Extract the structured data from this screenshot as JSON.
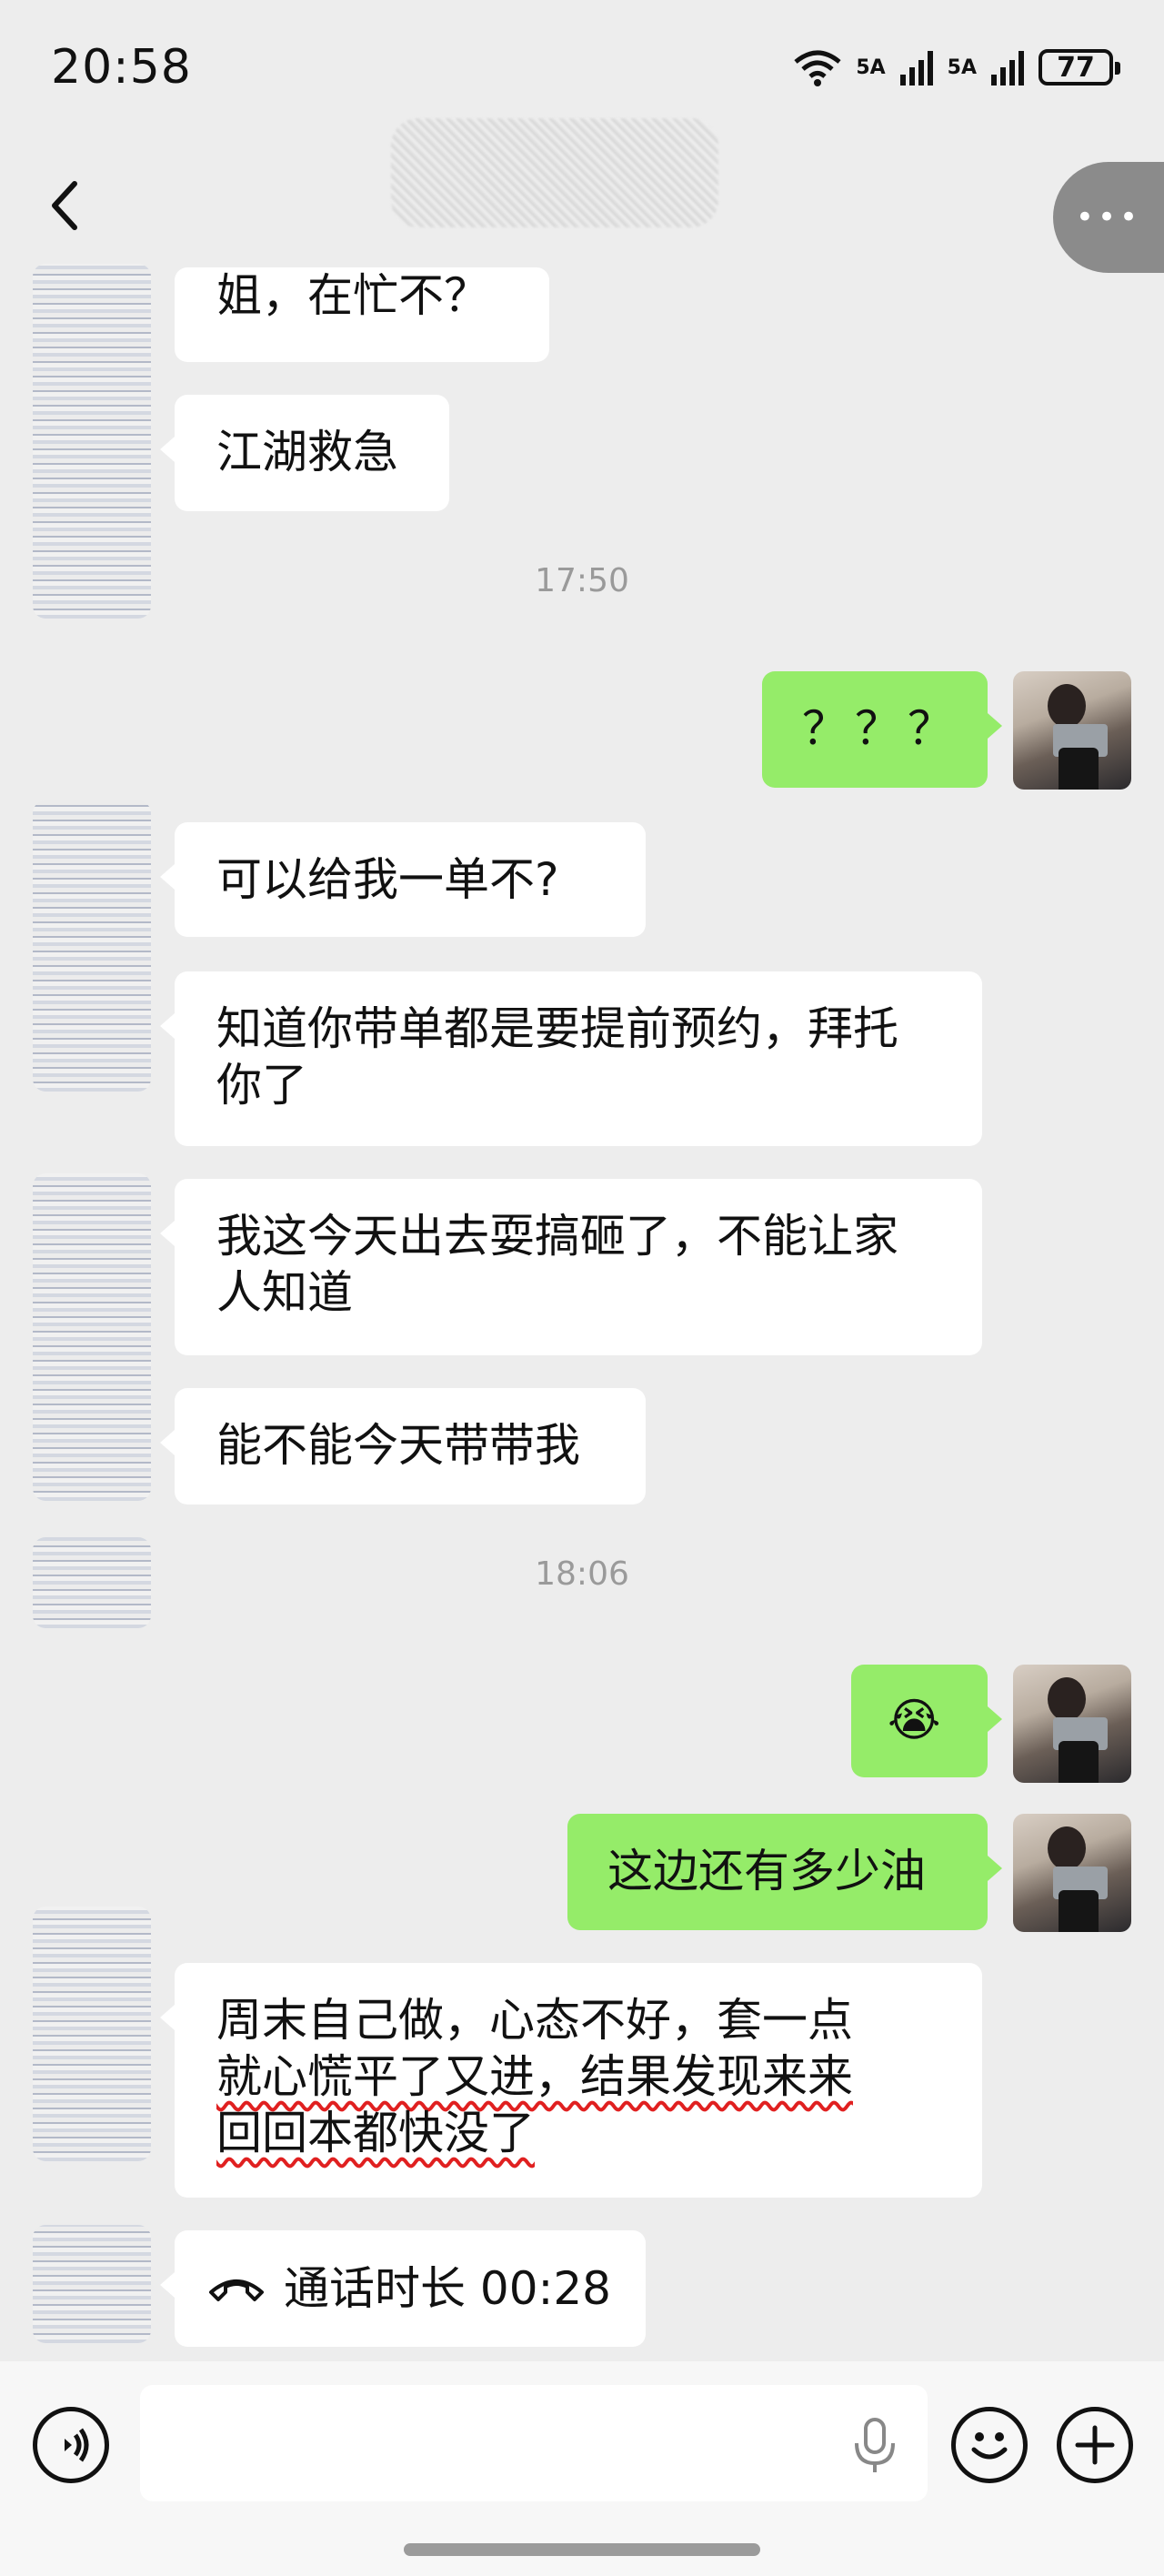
{
  "status_bar": {
    "time": "20:58",
    "battery": "77",
    "signal1": "5A",
    "signal2": "5A"
  },
  "nav": {
    "back_icon": "chevron-left-icon",
    "more_icon": "more-dots-icon"
  },
  "messages": [
    {
      "side": "in",
      "text": "姐，在忙不？"
    },
    {
      "side": "in",
      "text": "江湖救急"
    },
    {
      "side": "out",
      "text": "？？？"
    },
    {
      "side": "in",
      "text": "可以给我一单不?"
    },
    {
      "side": "in",
      "text": "知道你带单都是要提前预约，拜托你了"
    },
    {
      "side": "in",
      "text": "我这今天出去耍搞砸了，不能让家人知道"
    },
    {
      "side": "in",
      "text": "能不能今天带带我"
    },
    {
      "side": "out",
      "text": "😭"
    },
    {
      "side": "out",
      "text": "这边还有多少油"
    },
    {
      "side": "in",
      "text_line1": "周末自己做，心态不好，套一点",
      "text_line2": "就心慌平了又进，结果发现来来",
      "text_line3": "回回本都快没了"
    },
    {
      "side": "in",
      "call_icon": "phone-hangup-icon",
      "text": "通话时长 00:28"
    }
  ],
  "timestamps": [
    "17:50",
    "18:06"
  ],
  "input_bar": {
    "placeholder": "",
    "voice_icon": "voice-icon",
    "mic_icon": "mic-icon",
    "emoji_icon": "emoji-icon",
    "add_icon": "plus-icon"
  }
}
